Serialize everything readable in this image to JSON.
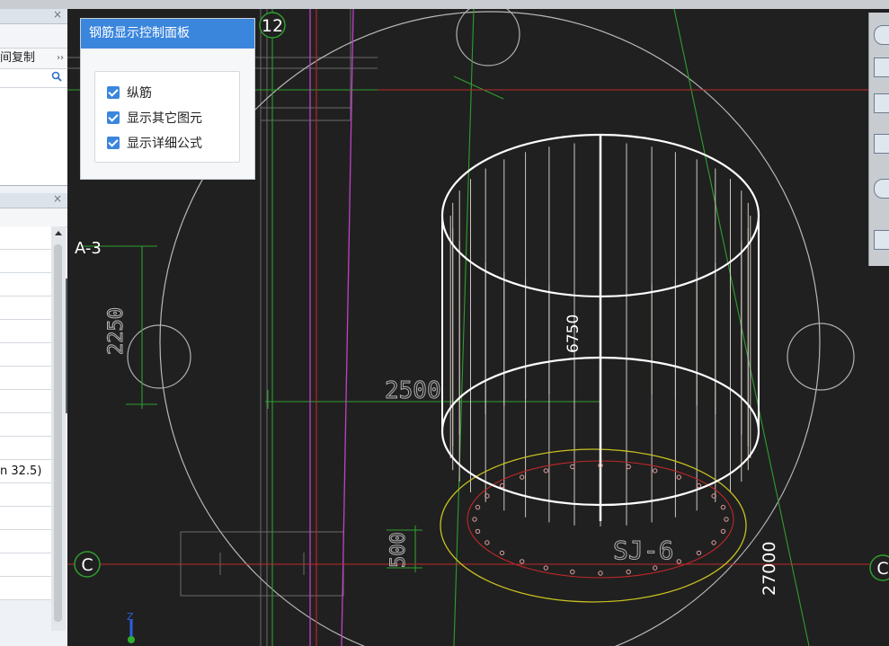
{
  "left_panel": {
    "pane1": {
      "label": "间复制",
      "more": "››",
      "search_icon": "search-icon",
      "close": "×"
    },
    "pane2": {
      "close": "×",
      "rows": [
        "",
        "",
        "",
        "",
        "",
        "",
        "",
        "",
        "",
        "",
        "n 32.5)",
        "",
        "",
        "",
        "",
        ""
      ]
    }
  },
  "control_panel": {
    "title": "钢筋显示控制面板",
    "options": [
      {
        "label": "纵筋",
        "checked": true
      },
      {
        "label": "显示其它图元",
        "checked": true
      },
      {
        "label": "显示详细公式",
        "checked": true
      }
    ]
  },
  "drawing": {
    "axis_labels": {
      "top": "12",
      "left_mid": "A-3",
      "left_bottom": "C",
      "right_bottom": "C"
    },
    "dimensions": {
      "d2250": "2250",
      "d2500": "2500",
      "d6750": "6750",
      "d500": "500",
      "d27000": "27000"
    },
    "component_label": "SJ-6",
    "colors": {
      "background": "#202020",
      "grid_green": "#2e9e2e",
      "magenta": "#c040c8",
      "red_line": "#c02828",
      "white": "#ffffff",
      "yellow": "#c8c020"
    }
  },
  "axis_gizmo": {
    "z": "Z"
  }
}
